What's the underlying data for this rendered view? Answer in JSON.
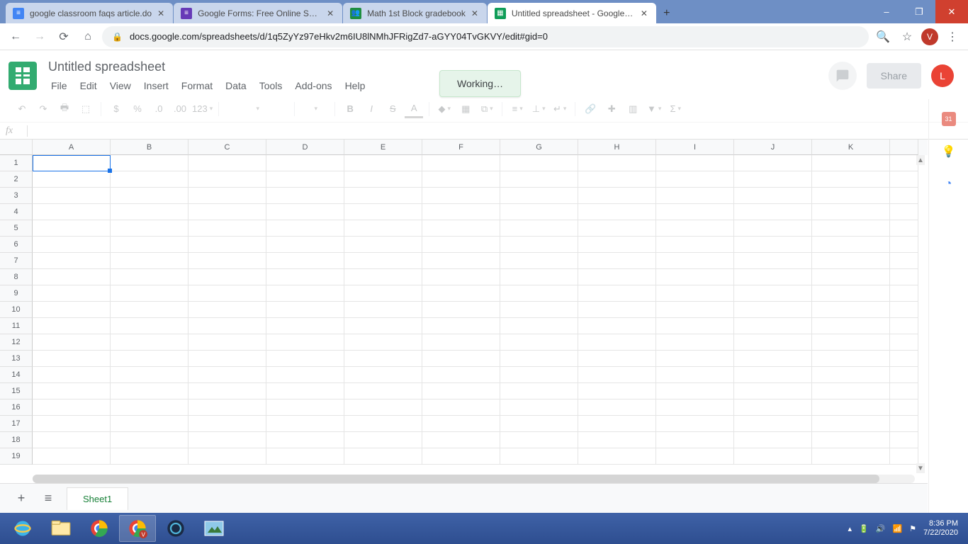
{
  "window": {
    "minimize": "–",
    "maximize": "❐",
    "close": "✕"
  },
  "browser": {
    "tabs": [
      {
        "label": "google classroom faqs article.do",
        "favicon_bg": "#4285f4",
        "favicon_txt": "≡"
      },
      {
        "label": "Google Forms: Free Online Surve",
        "favicon_bg": "#673ab7",
        "favicon_txt": "≡"
      },
      {
        "label": "Math 1st Block gradebook",
        "favicon_bg": "#1e8e3e",
        "favicon_txt": "👤"
      },
      {
        "label": "Untitled spreadsheet - Google Sh",
        "favicon_bg": "#0f9d58",
        "favicon_txt": "▦",
        "active": true
      }
    ],
    "newtab": "+",
    "url": "docs.google.com/spreadsheets/d/1q5ZyYz97eHkv2m6IU8lNMhJFRigZd7-aGYY04TvGKVY/edit#gid=0",
    "avatar": "V"
  },
  "sheets": {
    "title": "Untitled spreadsheet",
    "menus": [
      "File",
      "Edit",
      "View",
      "Insert",
      "Format",
      "Data",
      "Tools",
      "Add-ons",
      "Help"
    ],
    "share": "Share",
    "avatar": "L",
    "toast": "Working…",
    "toolbar": {
      "currency": "$",
      "percent": "%",
      "dec_dec": ".0",
      "dec_inc": ".00",
      "numfmt": "123",
      "bold": "B",
      "italic": "I",
      "strike": "S",
      "tcolor": "A"
    },
    "fx": "fx",
    "columns": [
      "A",
      "B",
      "C",
      "D",
      "E",
      "F",
      "G",
      "H",
      "I",
      "J",
      "K"
    ],
    "rows": [
      1,
      2,
      3,
      4,
      5,
      6,
      7,
      8,
      9,
      10,
      11,
      12,
      13,
      14,
      15,
      16,
      17,
      18,
      19
    ],
    "sheet_tab": "Sheet1",
    "side_cal": "31"
  },
  "taskbar": {
    "time": "8:36 PM",
    "date": "7/22/2020",
    "tray_up": "▴"
  }
}
